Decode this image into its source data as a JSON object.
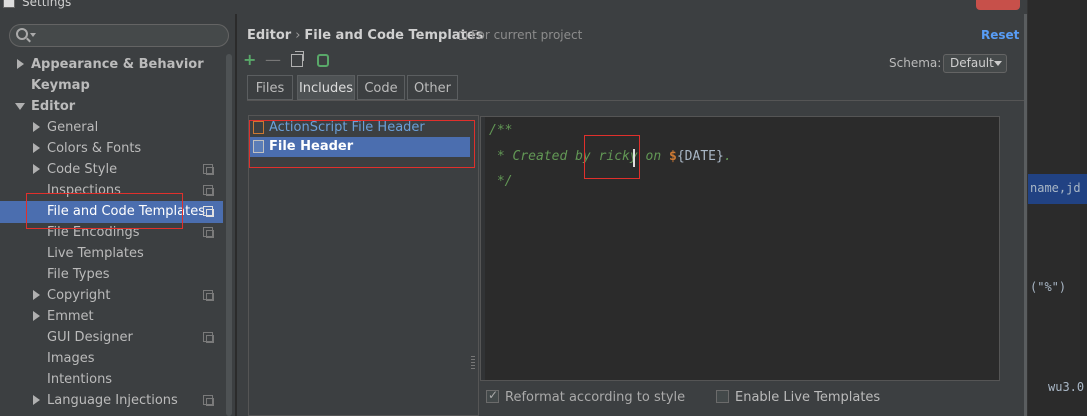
{
  "window": {
    "title": "Settings"
  },
  "sidebar": {
    "search_placeholder": "",
    "items": [
      {
        "label": "Appearance & Behavior",
        "level": 0,
        "expander": "collapsed",
        "bold": true,
        "project_icon": false
      },
      {
        "label": "Keymap",
        "level": 0,
        "expander": "none",
        "bold": true,
        "project_icon": false
      },
      {
        "label": "Editor",
        "level": 0,
        "expander": "expanded",
        "bold": true,
        "project_icon": false
      },
      {
        "label": "General",
        "level": 1,
        "expander": "collapsed",
        "bold": false,
        "project_icon": false
      },
      {
        "label": "Colors & Fonts",
        "level": 1,
        "expander": "collapsed",
        "bold": false,
        "project_icon": false
      },
      {
        "label": "Code Style",
        "level": 1,
        "expander": "collapsed",
        "bold": false,
        "project_icon": true
      },
      {
        "label": "Inspections",
        "level": 1,
        "expander": "none",
        "bold": false,
        "project_icon": true
      },
      {
        "label": "File and Code Templates",
        "level": 1,
        "expander": "none",
        "bold": false,
        "project_icon": true,
        "selected": true
      },
      {
        "label": "File Encodings",
        "level": 1,
        "expander": "none",
        "bold": false,
        "project_icon": true
      },
      {
        "label": "Live Templates",
        "level": 1,
        "expander": "none",
        "bold": false,
        "project_icon": false
      },
      {
        "label": "File Types",
        "level": 1,
        "expander": "none",
        "bold": false,
        "project_icon": false
      },
      {
        "label": "Copyright",
        "level": 1,
        "expander": "collapsed",
        "bold": false,
        "project_icon": true
      },
      {
        "label": "Emmet",
        "level": 1,
        "expander": "collapsed",
        "bold": false,
        "project_icon": false
      },
      {
        "label": "GUI Designer",
        "level": 1,
        "expander": "none",
        "bold": false,
        "project_icon": true
      },
      {
        "label": "Images",
        "level": 1,
        "expander": "none",
        "bold": false,
        "project_icon": false
      },
      {
        "label": "Intentions",
        "level": 1,
        "expander": "none",
        "bold": false,
        "project_icon": false
      },
      {
        "label": "Language Injections",
        "level": 1,
        "expander": "collapsed",
        "bold": false,
        "project_icon": true
      }
    ]
  },
  "header": {
    "breadcrumb_root": "Editor",
    "breadcrumb_sep": "›",
    "breadcrumb_page": "File and Code Templates",
    "scope_note": "For current project",
    "reset_label": "Reset"
  },
  "toolbar": {
    "add_glyph": "+",
    "remove_glyph": "—",
    "icons": [
      "plus-icon",
      "minus-icon",
      "copy-icon",
      "reset-to-default-icon"
    ],
    "schema_label": "Schema:",
    "schema_value": "Default"
  },
  "tabs": [
    {
      "label": "Files",
      "active": false
    },
    {
      "label": "Includes",
      "active": true
    },
    {
      "label": "Code",
      "active": false
    },
    {
      "label": "Other",
      "active": false
    }
  ],
  "templates": [
    {
      "label": "ActionScript File Header",
      "icon": "actionscript-file-icon",
      "selected": false
    },
    {
      "label": "File Header",
      "icon": "java-file-icon",
      "selected": true
    }
  ],
  "editor": {
    "line1": "/**",
    "line2_prefix": " * Created by ",
    "line2_user": "ricky",
    "line2_mid": " on ",
    "line2_dollar": "$",
    "line2_var": "{DATE}",
    "line2_end": ".",
    "line3": " */"
  },
  "footer": {
    "reformat_label": "Reformat according to style",
    "reformat_checked": true,
    "live_templates_label": "Enable Live Templates",
    "live_templates_checked": false
  },
  "background_ide": {
    "line1": "name,jd",
    "line2": "(\"%\")",
    "line3": "wu3.0"
  },
  "colors": {
    "selection": "#4b6eaf",
    "panel": "#3c3f41",
    "editor_bg": "#2b2b2b",
    "comment": "#629755",
    "link": "#589df6",
    "annotation_box": "#e0302c"
  }
}
